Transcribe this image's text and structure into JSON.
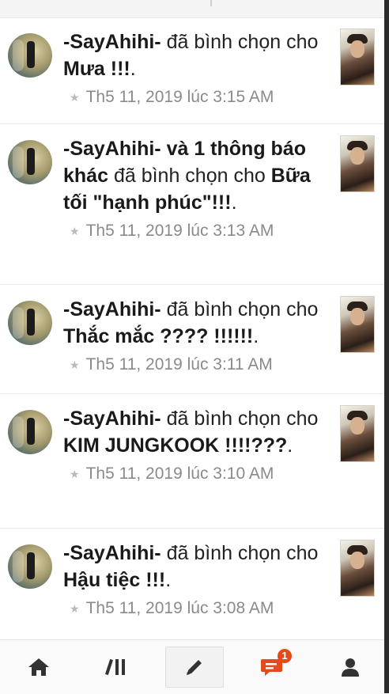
{
  "notifications": [
    {
      "user": "-SayAhihi-",
      "extra": "",
      "action": "đã bình chọn cho",
      "title": "Mưa !!!",
      "time": "Th5 11, 2019 lúc 3:15 AM"
    },
    {
      "user": "-SayAhihi-",
      "extra": "và 1 thông báo khác",
      "action": "đã bình chọn cho",
      "title": "Bữa tối \"hạnh phúc\"!!!",
      "time": "Th5 11, 2019 lúc 3:13 AM"
    },
    {
      "user": "-SayAhihi-",
      "extra": "",
      "action": "đã bình chọn cho",
      "title": "Thắc mắc ???? !!!!!!",
      "time": "Th5 11, 2019 lúc 3:11 AM"
    },
    {
      "user": "-SayAhihi-",
      "extra": "",
      "action": "đã bình chọn cho",
      "title": "KIM JUNGKOOK !!!!???",
      "time": "Th5 11, 2019 lúc 3:10 AM"
    },
    {
      "user": "-SayAhihi-",
      "extra": "",
      "action": "đã bình chọn cho",
      "title": "Hậu tiệc !!!",
      "time": "Th5 11, 2019 lúc 3:08 AM"
    }
  ],
  "bottom_nav": {
    "home_icon": "home-icon",
    "library_icon": "library-icon",
    "write_icon": "pencil-icon",
    "notifications_icon": "notification-icon",
    "notifications_badge": "1",
    "profile_icon": "profile-icon"
  },
  "colors": {
    "accent": "#e44b1b",
    "meta_text": "#8a8a8a",
    "nav_icon": "#333333"
  }
}
